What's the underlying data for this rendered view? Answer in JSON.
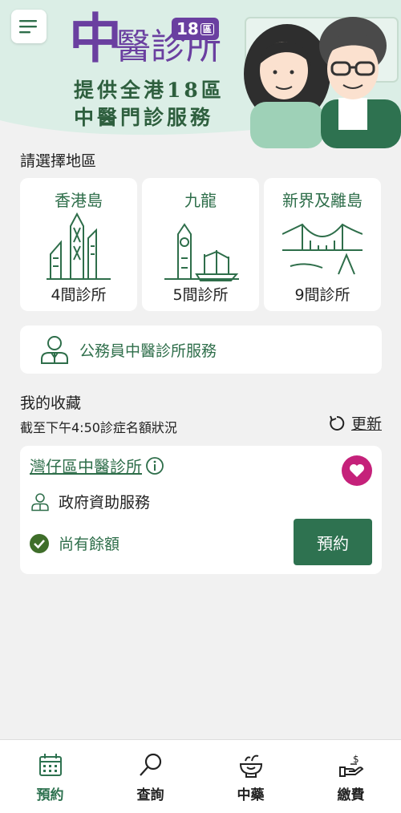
{
  "header": {
    "logo_main": "中",
    "logo_rest": "醫診所",
    "logo_badge": "18",
    "logo_badge_suffix": "區",
    "slogan_line1": "提供全港18區",
    "slogan_line2": "中醫門診服務"
  },
  "regions": {
    "title": "請選擇地區",
    "items": [
      {
        "name": "香港島",
        "count": "4間診所"
      },
      {
        "name": "九龍",
        "count": "5間診所"
      },
      {
        "name": "新界及離島",
        "count": "9間診所"
      }
    ]
  },
  "civil_service": {
    "label": "公務員中醫診所服務"
  },
  "favorites": {
    "title": "我的收藏",
    "subtitle": "截至下午4:50診症名額狀況",
    "refresh_label": "更新",
    "clinic": {
      "name": "灣仔區中醫診所",
      "service": "政府資助服務",
      "quota": "尚有餘額",
      "book_label": "預約"
    }
  },
  "nav": {
    "items": [
      {
        "label": "預約",
        "active": true
      },
      {
        "label": "查詢",
        "active": false
      },
      {
        "label": "中藥",
        "active": false
      },
      {
        "label": "繳費",
        "active": false
      }
    ]
  },
  "colors": {
    "accent_green": "#2e7250",
    "brand_purple": "#6a3fa0",
    "favorite_pink": "#c5217a",
    "banner_bg": "#dbeee6"
  }
}
